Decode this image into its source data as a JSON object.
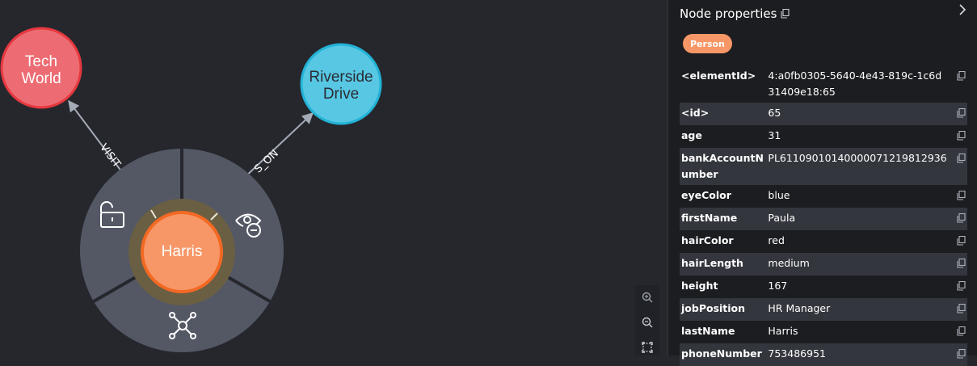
{
  "graph": {
    "nodes": [
      {
        "id": "tech",
        "label_lines": [
          "Tech",
          "World"
        ],
        "color": "#ed6c73",
        "stroke": "#e6383f",
        "text_color": "#ffffff"
      },
      {
        "id": "river",
        "label_lines": [
          "Riverside",
          "Drive"
        ],
        "color": "#57c7e3",
        "stroke": "#23b3d7",
        "text_color": "#2a2c34"
      },
      {
        "id": "harris",
        "label_lines": [
          "Harris"
        ],
        "color": "#f79767",
        "stroke": "#f36924",
        "text_color": "#ffffff"
      }
    ],
    "edges": [
      {
        "from": "harris",
        "to": "tech",
        "label": "VISIT"
      },
      {
        "from": "harris",
        "to": "river",
        "label": "S_ON"
      }
    ],
    "radial_menu": {
      "items": [
        {
          "name": "unlock-icon",
          "action": "unlock"
        },
        {
          "name": "hide-node-icon",
          "action": "dismiss"
        },
        {
          "name": "expand-graph-icon",
          "action": "expand"
        }
      ]
    }
  },
  "zoom_controls": {
    "zoom_in_icon": "zoom-in-icon",
    "zoom_out_icon": "zoom-out-icon",
    "fit_icon": "fit-to-screen-icon"
  },
  "panel": {
    "title": "Node properties",
    "label_badge": "Person",
    "badge_color": "#f79767",
    "properties": [
      {
        "key": "<elementId>",
        "value": "4:a0fb0305-5640-4e43-819c-1c6d31409e18:65"
      },
      {
        "key": "<id>",
        "value": "65"
      },
      {
        "key": "age",
        "value": "31"
      },
      {
        "key": "bankAccountNumber",
        "value": "PL61109010140000071219812936"
      },
      {
        "key": "eyeColor",
        "value": "blue"
      },
      {
        "key": "firstName",
        "value": "Paula"
      },
      {
        "key": "hairColor",
        "value": "red"
      },
      {
        "key": "hairLength",
        "value": "medium"
      },
      {
        "key": "height",
        "value": "167"
      },
      {
        "key": "jobPosition",
        "value": "HR Manager"
      },
      {
        "key": "lastName",
        "value": "Harris"
      },
      {
        "key": "phoneNumber",
        "value": "753486951"
      }
    ]
  }
}
